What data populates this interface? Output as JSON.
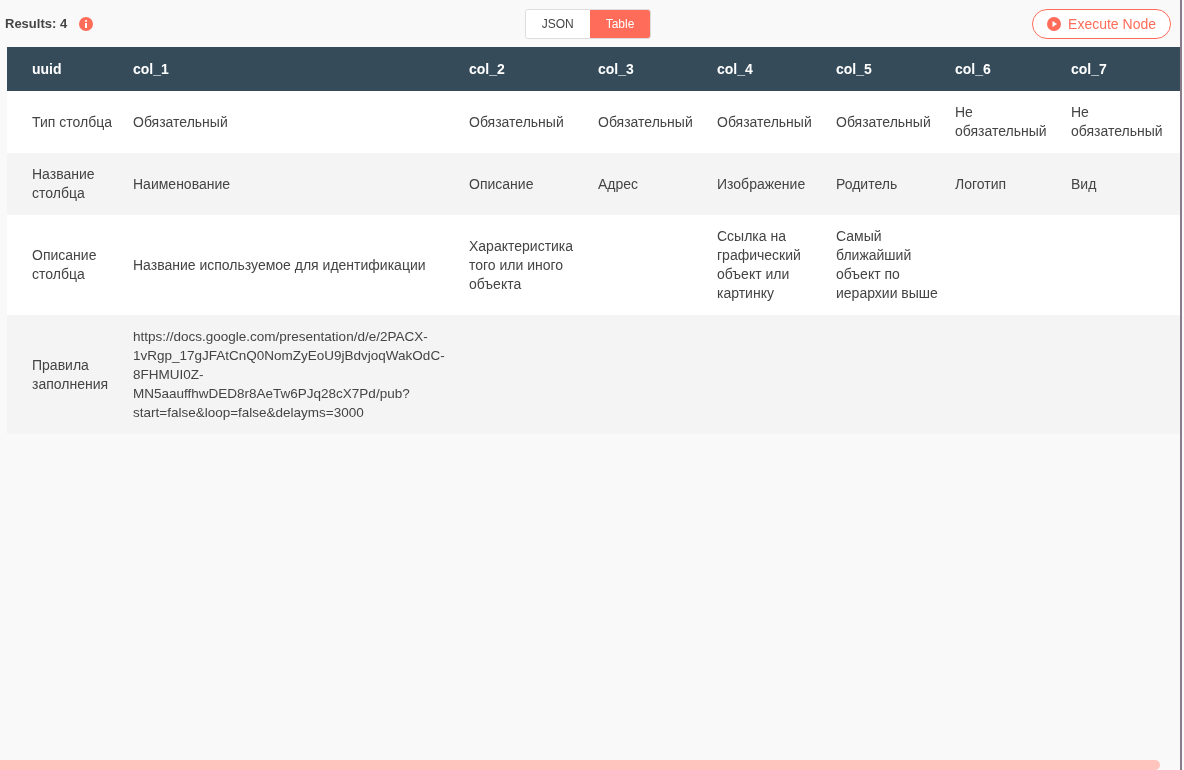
{
  "toolbar": {
    "results_label": "Results: 4",
    "view_toggle": [
      {
        "label": "JSON",
        "selected": false
      },
      {
        "label": "Table",
        "selected": true
      }
    ],
    "execute_button": "Execute Node"
  },
  "table": {
    "columns": [
      "uuid",
      "col_1",
      "col_2",
      "col_3",
      "col_4",
      "col_5",
      "col_6",
      "col_7"
    ],
    "rows": [
      {
        "cells": [
          "Тип столбца",
          "Обязательный",
          "Обязательный",
          "Обязательный",
          "Обязательный",
          "Обязательный",
          "Не обязательный",
          "Не обязательный"
        ]
      },
      {
        "cells": [
          "Название столбца",
          "Наименование",
          "Описание",
          "Адрес",
          "Изображение",
          "Родитель",
          "Логотип",
          "Вид"
        ]
      },
      {
        "cells": [
          "Описание столбца",
          "Название используемое для идентификации",
          "Характеристика того или иного объекта",
          null,
          "Ссылка на графический объект или картинку",
          "Самый ближайший объект по иерархии выше",
          null,
          null
        ]
      },
      {
        "cells": [
          "Правила заполнения",
          "https://docs.google.com/presentation/d/e/2PACX-1vRgp_17gJFAtCnQ0NomZyEoU9jBdvjoqWakOdC-8FHMUI0Z-MN5aauffhwDED8r8AeTw6PJq28cX7Pd/pub?start=false&loop=false&delayms=3000",
          null,
          null,
          null,
          null,
          null,
          null
        ]
      }
    ]
  }
}
